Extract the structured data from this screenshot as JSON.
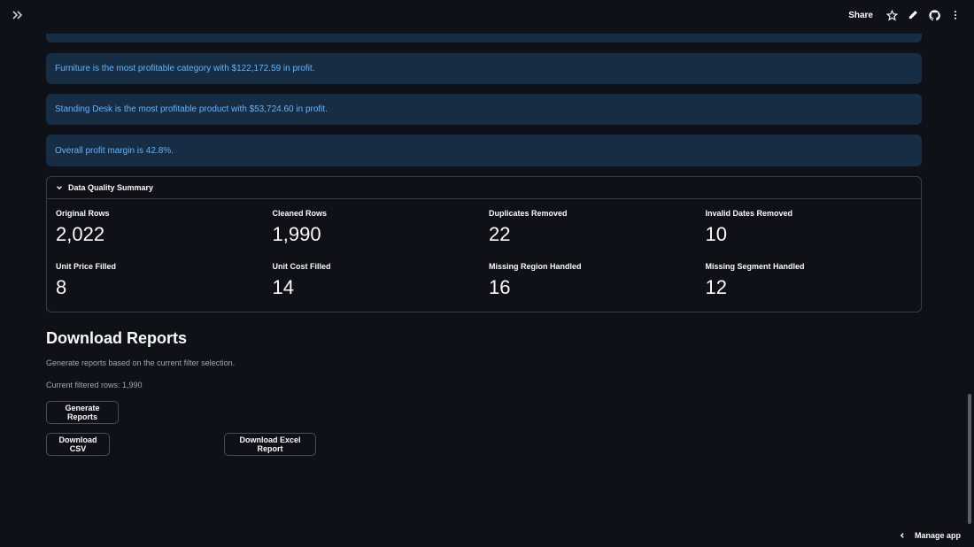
{
  "toolbar": {
    "share_label": "Share",
    "icons": [
      "double-chevron-right-icon",
      "star-icon",
      "pencil-icon",
      "github-icon",
      "kebab-menu-icon"
    ]
  },
  "alerts": [
    "",
    "Furniture is the most profitable category with $122,172.59 in profit.",
    "Standing Desk is the most profitable product with $53,724.60 in profit.",
    "Overall profit margin is 42.8%."
  ],
  "data_quality": {
    "title": "Data Quality Summary",
    "metrics": [
      {
        "label": "Original Rows",
        "value": "2,022"
      },
      {
        "label": "Cleaned Rows",
        "value": "1,990"
      },
      {
        "label": "Duplicates Removed",
        "value": "22"
      },
      {
        "label": "Invalid Dates Removed",
        "value": "10"
      },
      {
        "label": "Unit Price Filled",
        "value": "8"
      },
      {
        "label": "Unit Cost Filled",
        "value": "14"
      },
      {
        "label": "Missing Region Handled",
        "value": "16"
      },
      {
        "label": "Missing Segment Handled",
        "value": "12"
      }
    ]
  },
  "download": {
    "title": "Download Reports",
    "description": "Generate reports based on the current filter selection.",
    "filtered_rows": "Current filtered rows: 1,990",
    "generate_label": "Generate Reports",
    "csv_label": "Download CSV",
    "excel_label": "Download Excel Report"
  },
  "footer": {
    "manage_label": "Manage app"
  },
  "colors": {
    "background": "#0e1117",
    "alert_bg": "#172d43",
    "alert_text": "#60b4ff"
  }
}
